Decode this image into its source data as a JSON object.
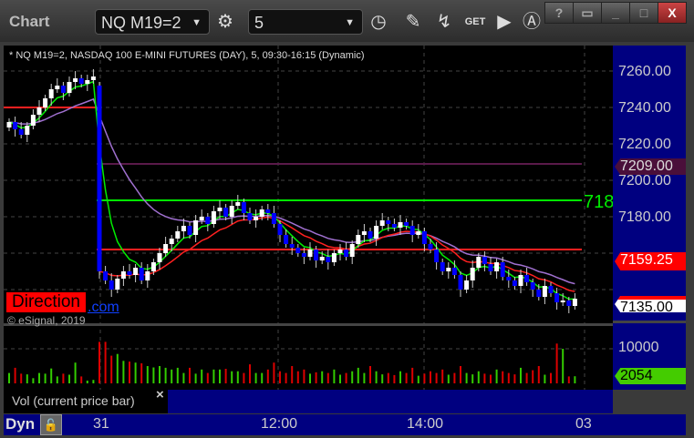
{
  "window": {
    "title": "Chart",
    "symbol": "NQ M19=2",
    "interval": "5",
    "help": "?",
    "minimize": "_",
    "maximize": "□",
    "close": "X"
  },
  "toolbar_icons": [
    "gear-icon",
    "clock-icon",
    "pencil-icon",
    "study-icon",
    "get-icon",
    "play-icon",
    "a-icon"
  ],
  "legend": "* NQ M19=2, NASDAQ 100 E-MINI FUTURES (DAY), 5, 09:30-16:15 (Dynamic)",
  "watermark": {
    "direction": "Direction",
    "link": ".com",
    "copyright": "© eSignal, 2019"
  },
  "price_axis": [
    "7260.00",
    "7240.00",
    "7220.00",
    "7200.00",
    "7180.00"
  ],
  "tags": {
    "level": "7209.00",
    "last_red": "7159.25",
    "last": "7135.00",
    "vol_scale": "10000",
    "vol": "2054"
  },
  "line_label": "718",
  "volume_panel": {
    "label": "Vol (current price bar)",
    "close": "×"
  },
  "bottom": {
    "dyn": "Dyn",
    "times": [
      "31",
      "12:00",
      "14:00",
      "03"
    ]
  },
  "colors": {
    "up": "#ffffff",
    "down": "#0000ff",
    "vol_up": "#33cc00",
    "vol_down": "#dd0000",
    "axis_bg": "#000080"
  },
  "chart_data": {
    "type": "candlestick",
    "ylim": [
      7120,
      7274
    ],
    "closes": [
      7232,
      7228,
      7225,
      7230,
      7236,
      7240,
      7245,
      7250,
      7252,
      7248,
      7254,
      7256,
      7253,
      7255,
      7257,
      7150,
      7145,
      7140,
      7146,
      7150,
      7148,
      7152,
      7145,
      7150,
      7155,
      7160,
      7165,
      7168,
      7172,
      7175,
      7170,
      7178,
      7180,
      7176,
      7183,
      7185,
      7180,
      7186,
      7188,
      7182,
      7178,
      7180,
      7184,
      7182,
      7176,
      7170,
      7165,
      7163,
      7160,
      7158,
      7162,
      7156,
      7158,
      7155,
      7160,
      7162,
      7158,
      7165,
      7170,
      7172,
      7168,
      7175,
      7178,
      7176,
      7174,
      7177,
      7175,
      7170,
      7172,
      7165,
      7162,
      7155,
      7150,
      7152,
      7148,
      7140,
      7145,
      7152,
      7158,
      7154,
      7150,
      7155,
      7147,
      7145,
      7142,
      7148,
      7144,
      7140,
      7136,
      7142,
      7138,
      7133,
      7134,
      7131,
      7135
    ],
    "volumes": [
      3000,
      4500,
      2800,
      2600,
      1500,
      3000,
      2800,
      4300,
      2000,
      2800,
      2500,
      6000,
      2000,
      800,
      1000,
      12000,
      12000,
      8000,
      8500,
      6500,
      6300,
      6000,
      5800,
      5000,
      4600,
      5000,
      4500,
      4000,
      4500,
      3000,
      4500,
      2800,
      4000,
      3000,
      4000,
      4000,
      4200,
      3500,
      3500,
      3000,
      5500,
      3000,
      3000,
      4000,
      6000,
      3500,
      3000,
      5000,
      3500,
      4000,
      2800,
      3200,
      3500,
      3000,
      4000,
      2500,
      3000,
      3500,
      4500,
      3000,
      5000,
      3500,
      2600,
      3000,
      2400,
      3500,
      3000,
      4500,
      2200,
      2800,
      3500,
      3000,
      4000,
      2500,
      3000,
      5000,
      3000,
      2600,
      3500,
      2800,
      2500,
      4000,
      3500,
      3000,
      2600,
      4500,
      3000,
      3800,
      5000,
      2500,
      3000,
      11500,
      10000,
      2000,
      2054
    ],
    "hlines": [
      {
        "price": 7209,
        "color": "#5a1a4a"
      },
      {
        "price": 7189,
        "color": "#00ee00"
      },
      {
        "price": 7162,
        "color": "#ff2020"
      },
      {
        "price": 7240,
        "color": "#ff2020",
        "end_bar": 15
      }
    ]
  }
}
